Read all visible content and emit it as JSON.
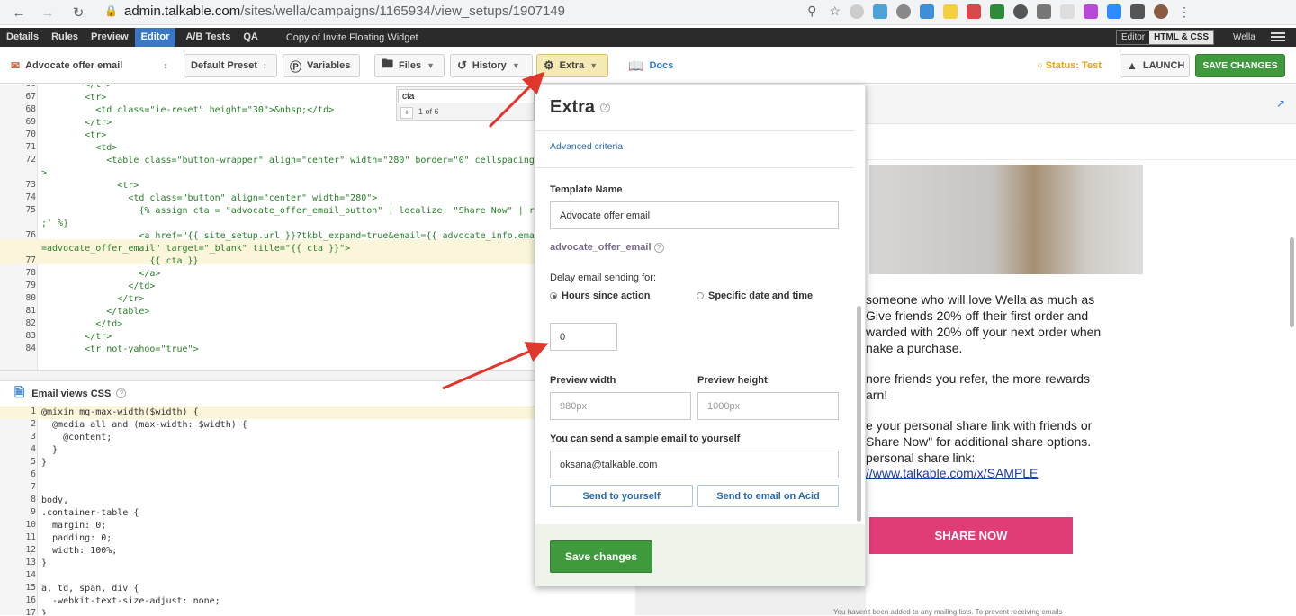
{
  "browser": {
    "url_host": "admin.talkable.com",
    "url_path": "/sites/wella/campaigns/1165934/view_setups/1907149"
  },
  "appbar": {
    "tabs": [
      {
        "label": "Details"
      },
      {
        "label": "Rules"
      },
      {
        "label": "Preview"
      },
      {
        "label": "Editor"
      },
      {
        "label": "A/B Tests"
      },
      {
        "label": "QA"
      }
    ],
    "breadcrumb": "Copy of Invite Floating Widget",
    "editor_toggle": {
      "left": "Editor",
      "right": "HTML & CSS"
    },
    "site": "Wella"
  },
  "toolbar": {
    "view_select": "Advocate offer email",
    "preset": "Default Preset",
    "variables": "Variables",
    "files": "Files",
    "history": "History",
    "extra": "Extra",
    "docs": "Docs",
    "status": "Status: Test",
    "launch": "LAUNCH",
    "save": "SAVE CHANGES"
  },
  "find": {
    "value": "cta",
    "count": "1 of 6"
  },
  "code_lines": [
    {
      "n": "66",
      "t": "        </tr>"
    },
    {
      "n": "67",
      "t": "        <tr>"
    },
    {
      "n": "68",
      "t": "          <td class=\"ie-reset\" height=\"30\">&nbsp;</td>"
    },
    {
      "n": "69",
      "t": "        </tr>"
    },
    {
      "n": "70",
      "t": "        <tr>"
    },
    {
      "n": "71",
      "t": "          <td>"
    },
    {
      "n": "72",
      "t": "            <table class=\"button-wrapper\" align=\"center\" width=\"280\" border=\"0\" cellspacing=\""
    },
    {
      "n": "",
      "t": ">"
    },
    {
      "n": "73",
      "t": "              <tr>"
    },
    {
      "n": "74",
      "t": "                <td class=\"button\" align=\"center\" width=\"280\">"
    },
    {
      "n": "75",
      "t": "                  {% assign cta = \"advocate_offer_email_button\" | localize: \"Share Now\" | rep"
    },
    {
      "n": "",
      "t": ";' %}"
    },
    {
      "n": "76",
      "t": "                  <a href=\"{{ site_setup.url }}?tkbl_expand=true&email={{ advocate_info.email"
    },
    {
      "n": "",
      "t": "=advocate_offer_email\" target=\"_blank\" title=\"{{ cta }}\">"
    },
    {
      "n": "77",
      "t": "                    {{ cta }}"
    },
    {
      "n": "78",
      "t": "                  </a>"
    },
    {
      "n": "79",
      "t": "                </td>"
    },
    {
      "n": "80",
      "t": "              </tr>"
    },
    {
      "n": "81",
      "t": "            </table>"
    },
    {
      "n": "82",
      "t": "          </td>"
    },
    {
      "n": "83",
      "t": "        </tr>"
    },
    {
      "n": "84",
      "t": "        <tr not-yahoo=\"true\">"
    }
  ],
  "css_panel": {
    "title": "Email views CSS"
  },
  "css_lines": [
    {
      "n": "1",
      "t": "@mixin mq-max-width($width) {"
    },
    {
      "n": "2",
      "t": "  @media all and (max-width: $width) {"
    },
    {
      "n": "3",
      "t": "    @content;"
    },
    {
      "n": "4",
      "t": "  }"
    },
    {
      "n": "5",
      "t": "}"
    },
    {
      "n": "6",
      "t": ""
    },
    {
      "n": "7",
      "t": ""
    },
    {
      "n": "8",
      "t": "body,"
    },
    {
      "n": "9",
      "t": ".container-table {"
    },
    {
      "n": "10",
      "t": "  margin: 0;"
    },
    {
      "n": "11",
      "t": "  padding: 0;"
    },
    {
      "n": "12",
      "t": "  width: 100%;"
    },
    {
      "n": "13",
      "t": "}"
    },
    {
      "n": "14",
      "t": ""
    },
    {
      "n": "15",
      "t": "a, td, span, div {"
    },
    {
      "n": "16",
      "t": "  -webkit-text-size-adjust: none;"
    },
    {
      "n": "17",
      "t": "}"
    }
  ],
  "popup": {
    "title": "Extra",
    "advanced": "Advanced criteria",
    "template_label": "Template Name",
    "template_value": "Advocate offer email",
    "slug": "advocate_offer_email",
    "delay_label": "Delay email sending for:",
    "radio_hours": "Hours since action",
    "radio_date": "Specific date and time",
    "delay_value": "0",
    "width_label": "Preview width",
    "width_placeholder": "980px",
    "height_label": "Preview height",
    "height_placeholder": "1000px",
    "sample_label": "You can send a sample email to yourself",
    "sample_email": "oksana@talkable.com",
    "send_yourself": "Send to yourself",
    "send_acid": "Send to email on Acid",
    "save": "Save changes"
  },
  "preview": {
    "lines": [
      "someone who will love Wella as much as",
      "Give friends 20% off their first order and",
      "warded with 20% off your next order when",
      "nake a purchase.",
      "nore friends you refer, the more rewards",
      "arn!",
      "e your personal share link with friends or",
      "Share Now\" for additional share options.",
      "personal share link:"
    ],
    "link": "//www.talkable.com/x/SAMPLE",
    "share_button": "SHARE NOW",
    "footer": "You haven't been added to any mailing lists. To prevent receiving emails"
  },
  "colors": {
    "accent": "#3a77c5",
    "save": "#3e9a3c",
    "status": "#e6a516",
    "share": "#e03c77"
  }
}
